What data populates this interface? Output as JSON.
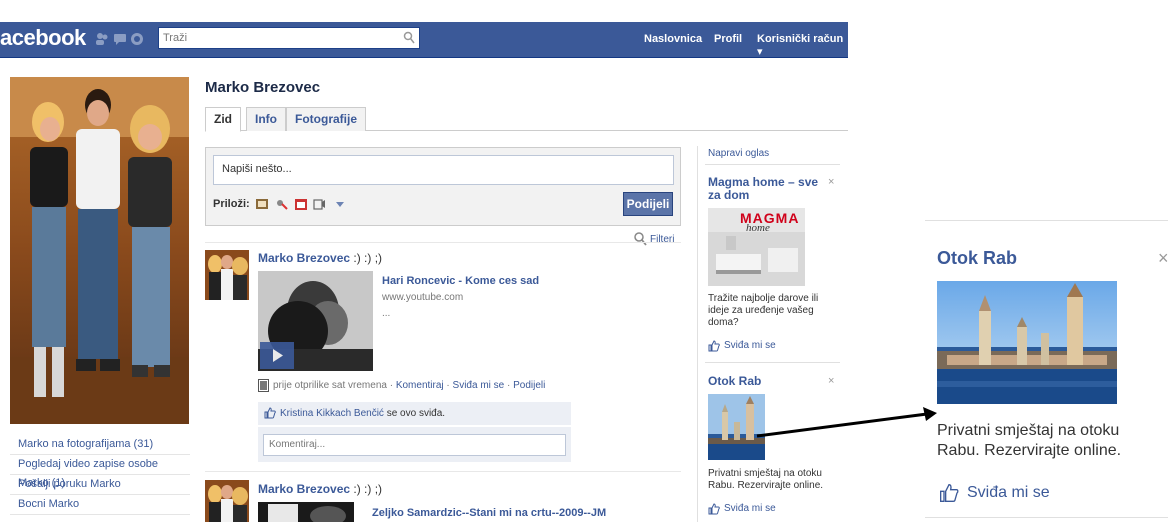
{
  "topbar": {
    "logo": "acebook",
    "search_placeholder": "Traži",
    "nav": [
      "Naslovnica",
      "Profil",
      "Korisnički račun ▾"
    ]
  },
  "profile": {
    "name": "Marko Brezovec",
    "tabs": [
      "Zid",
      "Info",
      "Fotografije"
    ],
    "left_links": [
      "Marko na fotografijama (31)",
      "Pogledaj video zapise osobe Marko (1)",
      "Pošalji poruku Marko",
      "Bocni Marko"
    ]
  },
  "composer": {
    "placeholder": "Napiši nešto...",
    "attach_label": "Priloži:",
    "share_button": "Podijeli"
  },
  "feed": {
    "filter_label": "Filteri",
    "posts": [
      {
        "author": "Marko Brezovec",
        "status": " :) :) ;)",
        "link_title": "Hari Roncevic - Kome ces sad",
        "link_domain": "www.youtube.com",
        "link_desc": "...",
        "time": "prije otprilike sat vremena",
        "actions": [
          "Komentiraj",
          "Sviđa mi se",
          "Podijeli"
        ],
        "like_person": "Kristina Kikkach Benčić",
        "like_suffix": " se ovo sviđa.",
        "comment_placeholder": "Komentiraj..."
      },
      {
        "author": "Marko Brezovec",
        "status": " :) :) ;)",
        "link_title": "Zeljko Samardzic--Stani mi na crtu--2009--JM"
      }
    ]
  },
  "ads": {
    "create_label": "Napravi oglas",
    "items": [
      {
        "title": "Magma home – sve za dom",
        "logo_text": "MAGMA",
        "logo_sub": "home",
        "text": "Tražite najbolje darove ili ideje za uređenje vašeg doma?",
        "like": "Sviđa mi se"
      },
      {
        "title": "Otok Rab",
        "text": "Privatni smještaj na otoku Rabu. Rezervirajte online.",
        "like": "Sviđa mi se"
      }
    ],
    "close_symbol": "×"
  },
  "zoom": {
    "title": "Otok Rab",
    "close_symbol": "×",
    "text": "Privatni smještaj na otoku Rabu. Rezervirajte online.",
    "like": "Sviđa mi se"
  },
  "colors": {
    "brand": "#3b5998",
    "brand_dark": "#133783",
    "like_box": "#eceff5"
  }
}
